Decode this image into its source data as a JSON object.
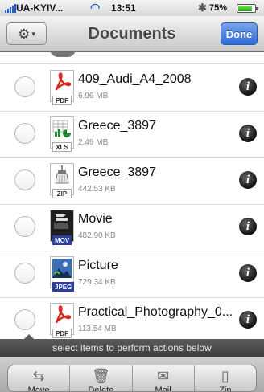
{
  "status_bar": {
    "carrier": "UA-KYIV...",
    "time": "13:51",
    "battery": "75%",
    "battery_level": 0.75,
    "icons": [
      "signal-icon",
      "wifi-icon",
      "bluetooth-icon",
      "battery-icon"
    ]
  },
  "nav": {
    "title": "Documents",
    "done_label": "Done",
    "gear_icon": "⚙",
    "caret_icon": "▾"
  },
  "files": [
    {
      "name": "409_Audi_A4_2008",
      "size": "6.96 MB",
      "type": "PDF"
    },
    {
      "name": "Greece_3897",
      "size": "2.49 MB",
      "type": "XLS"
    },
    {
      "name": "Greece_3897",
      "size": "442.53 KB",
      "type": "ZIP"
    },
    {
      "name": "Movie",
      "size": "482.90 KB",
      "type": "MOV"
    },
    {
      "name": "Picture",
      "size": "729.34 KB",
      "type": "JPEG"
    },
    {
      "name": "Practical_Photography_0...",
      "size": "113.54 MB",
      "type": "PDF"
    }
  ],
  "info_glyph": "i",
  "hint": "select items to perform actions below",
  "toolbar": {
    "items": [
      {
        "label": "Move",
        "icon": "⇆"
      },
      {
        "label": "Delete",
        "icon": "🗑"
      },
      {
        "label": "Mail",
        "icon": "✉"
      },
      {
        "label": "Zip",
        "icon": "▯"
      }
    ]
  },
  "colors": {
    "accent": "#2f6bd9",
    "pdf_red": "#d8261c",
    "mov_blue": "#2a3ea8"
  }
}
